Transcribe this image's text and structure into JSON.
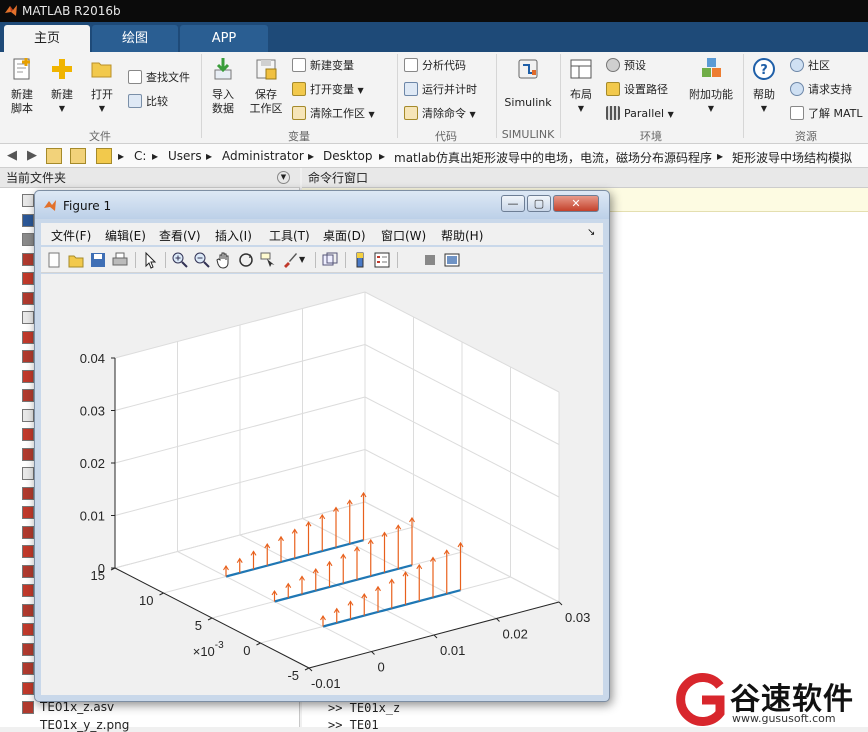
{
  "app": {
    "title": "MATLAB R2016b"
  },
  "tabs": [
    {
      "label": "主页",
      "active": true
    },
    {
      "label": "绘图",
      "active": false
    },
    {
      "label": "APP",
      "active": false
    }
  ],
  "ribbon": {
    "file": {
      "group_label": "文件",
      "new_script": "新建\n脚本",
      "new_script_l1": "新建",
      "new_script_l2": "脚本",
      "new": "新建",
      "open": "打开",
      "find_files": "查找文件",
      "compare": "比较"
    },
    "variable": {
      "group_label": "变量",
      "import_l1": "导入",
      "import_l2": "数据",
      "save_l1": "保存",
      "save_l2": "工作区",
      "new_variable": "新建变量",
      "open_variable": "打开变量",
      "clear_workspace": "清除工作区"
    },
    "code": {
      "group_label": "代码",
      "analyze": "分析代码",
      "run_time": "运行并计时",
      "clear_commands": "清除命令"
    },
    "simulink": {
      "group_label": "SIMULINK",
      "label": "Simulink"
    },
    "environment": {
      "group_label": "环境",
      "layout": "布局",
      "preferences": "预设",
      "set_path": "设置路径",
      "parallel": "Parallel",
      "addons": "附加功能"
    },
    "resources": {
      "group_label": "资源",
      "help": "帮助",
      "community": "社区",
      "request_support": "请求支持",
      "learn_matlab": "了解 MATL"
    }
  },
  "address": {
    "crumbs": [
      "C:",
      "Users",
      "Administrator",
      "Desktop",
      "matlab仿真出矩形波导中的电场，电流，磁场分布源码程序",
      "矩形波导中场结构模拟"
    ]
  },
  "current_folder": {
    "header": "当前文件夹",
    "files_visible": [
      "TE01x_z.asv",
      "TE01x_y_z.png"
    ]
  },
  "command_window": {
    "header": "命令行窗口",
    "lines": [
      ">> TE01x_z",
      ">> TE01"
    ]
  },
  "figure": {
    "title": "Figure 1",
    "menu": [
      "文件(F)",
      "编辑(E)",
      "查看(V)",
      "插入(I)",
      "工具(T)",
      "桌面(D)",
      "窗口(W)",
      "帮助(H)"
    ]
  },
  "chart_data": {
    "type": "quiver3",
    "title": "",
    "xlabel": "",
    "ylabel": "",
    "zlabel": "",
    "x_ticks": [
      "-0.01",
      "0",
      "0.01",
      "0.02",
      "0.03"
    ],
    "xlim": [
      -0.01,
      0.03
    ],
    "y_ticks": [
      "-5",
      "0",
      "5",
      "10",
      "15"
    ],
    "y_exponent": "× 10^-3",
    "y_exponent_base": "×10",
    "y_exponent_power": "-3",
    "ylim": [
      -5,
      15
    ],
    "z_ticks": [
      "0",
      "0.01",
      "0.02",
      "0.03",
      "0.04"
    ],
    "zlim": [
      0,
      0.04
    ],
    "grid": true,
    "series": [
      {
        "color": "#e8601c",
        "lines_y": [
          0,
          5,
          10
        ],
        "x_range": [
          0,
          0.022
        ],
        "arrows_per_line": 11,
        "magnitude_range": [
          0.002,
          0.009
        ]
      },
      {
        "color": "#1f77b4",
        "lines_y": [
          0,
          5,
          10
        ],
        "x_range": [
          0,
          0.022
        ]
      }
    ]
  },
  "watermark": {
    "name": "谷速软件",
    "url": "www.gususoft.com"
  },
  "colors": {
    "tab_bg": "#1e4a78",
    "arrow": "#e8601c",
    "line": "#1f77b4",
    "watermark_red": "#d8262c"
  }
}
